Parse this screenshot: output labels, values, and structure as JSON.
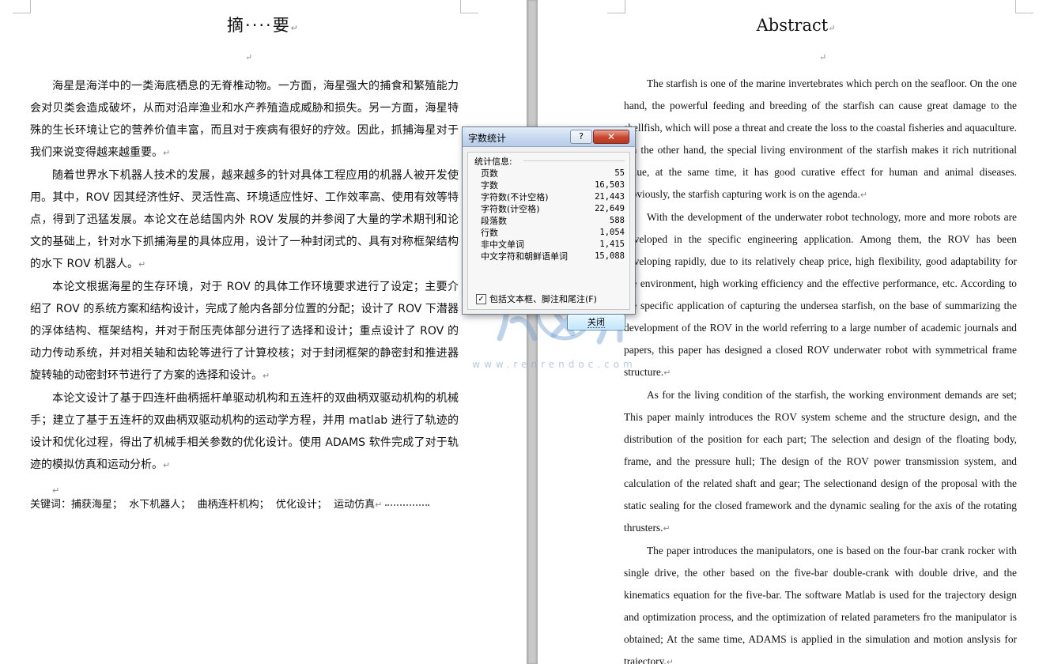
{
  "left_page": {
    "title": "摘····要",
    "paragraphs": [
      "海星是海洋中的一类海底栖息的无脊椎动物。一方面，海星强大的捕食和繁殖能力会对贝类会造成破坏，从而对沿岸渔业和水产养殖造成威胁和损失。另一方面，海星特殊的生长环境让它的营养价值丰富，而且对于疾病有很好的疗效。因此，抓捕海星对于我们来说变得越来越重要。",
      "随着世界水下机器人技术的发展，越来越多的针对具体工程应用的机器人被开发使用。其中，ROV 因其经济性好、灵活性高、环境适应性好、工作效率高、使用有效等特点，得到了迅猛发展。本论文在总结国内外 ROV 发展的并参阅了大量的学术期刊和论文的基础上，针对水下抓捕海星的具体应用，设计了一种封闭式的、具有对称框架结构的水下 ROV 机器人。",
      "本论文根据海星的生存环境，对于 ROV 的具体工作环境要求进行了设定；主要介绍了 ROV 的系统方案和结构设计，完成了舱内各部分位置的分配；设计了 ROV 下潜器的浮体结构、框架结构，并对于耐压壳体部分进行了选择和设计；重点设计了 ROV 的动力传动系统，并对相关轴和齿轮等进行了计算校核；对于封闭框架的静密封和推进器旋转轴的动密封环节进行了方案的选择和设计。",
      "本论文设计了基于四连杆曲柄摇杆单驱动机构和五连杆的双曲柄双驱动机构的机械手；建立了基于五连杆的双曲柄双驱动机构的运动学方程，并用 matlab 进行了轨迹的设计和优化过程，得出了机械手相关参数的优化设计。使用 ADAMS 软件完成了对于轨迹的模拟仿真和运动分析。"
    ],
    "keywords_label": "关键词：",
    "keywords": [
      "捕获海星；",
      "水下机器人；",
      "曲柄连杆机构；",
      "优化设计；",
      "运动仿真"
    ]
  },
  "right_page": {
    "title": "Abstract",
    "paragraphs": [
      "The starfish is one of the marine invertebrates which perch on the seafloor. On the one hand, the powerful feeding and breeding of the starfish can cause great damage to the shellfish, which will pose a threat and create the loss to the coastal fisheries and aquaculture. On the other hand, the special living environment of the starfish makes it rich nutritional value, at the same time, it has good curative effect for human and animal diseases. Obviously, the starfish capturing work is on the agenda.",
      "With the development of the underwater robot technology, more and more robots are developed in the specific engineering application. Among them, the ROV has been developing rapidly, due to its relatively cheap price, high flexibility, good adaptability for the environment, high working efficiency and the effective performance, etc. According to the specific application of capturing the undersea starfish, on the base of summarizing the development of the ROV in the world referring to a large number of academic journals and papers, this paper has designed a closed ROV underwater robot with symmetrical frame structure.",
      "As for the living condition of the starfish, the working environment demands are set; This paper mainly introduces the ROV system scheme and the structure design, and the distribution of the position for each part; The selection and design of the floating body, frame, and the pressure hull; The design of the ROV power transmission system, and calculation of the related shaft and gear; The selectionand design of the proposal with the static sealing for the closed framework and the dynamic sealing for the axis of the rotating thrusters.",
      "The paper introduces the manipulators, one is based on the four-bar crank rocker with single drive, the other based on the five-bar double-crank with double drive, and the kinematics equation for the five-bar. The software Matlab is used for the trajectory design and optimization process, and the optimization of related parameters fro the manipulator is obtained; At the same time, ADAMS is applied in the simulation and motion anslysis for trajectory."
    ]
  },
  "dialog": {
    "title": "字数统计",
    "help_label": "?",
    "close_x": "✕",
    "section_label": "统计信息:",
    "stats": [
      {
        "label": "页数",
        "value": "55"
      },
      {
        "label": "字数",
        "value": "16,503"
      },
      {
        "label": "字符数(不计空格)",
        "value": "21,443"
      },
      {
        "label": "字符数(计空格)",
        "value": "22,649"
      },
      {
        "label": "段落数",
        "value": "588"
      },
      {
        "label": "行数",
        "value": "1,054"
      },
      {
        "label": "非中文单词",
        "value": "1,415"
      },
      {
        "label": "中文字符和朝鲜语单词",
        "value": "15,088"
      }
    ],
    "checkbox_label": "包括文本框、脚注和尾注(F)",
    "checkbox_checked": true,
    "close_button": "关闭"
  },
  "watermark": {
    "text": "www.renrendoc.com",
    "color": "#6f9fcf"
  }
}
